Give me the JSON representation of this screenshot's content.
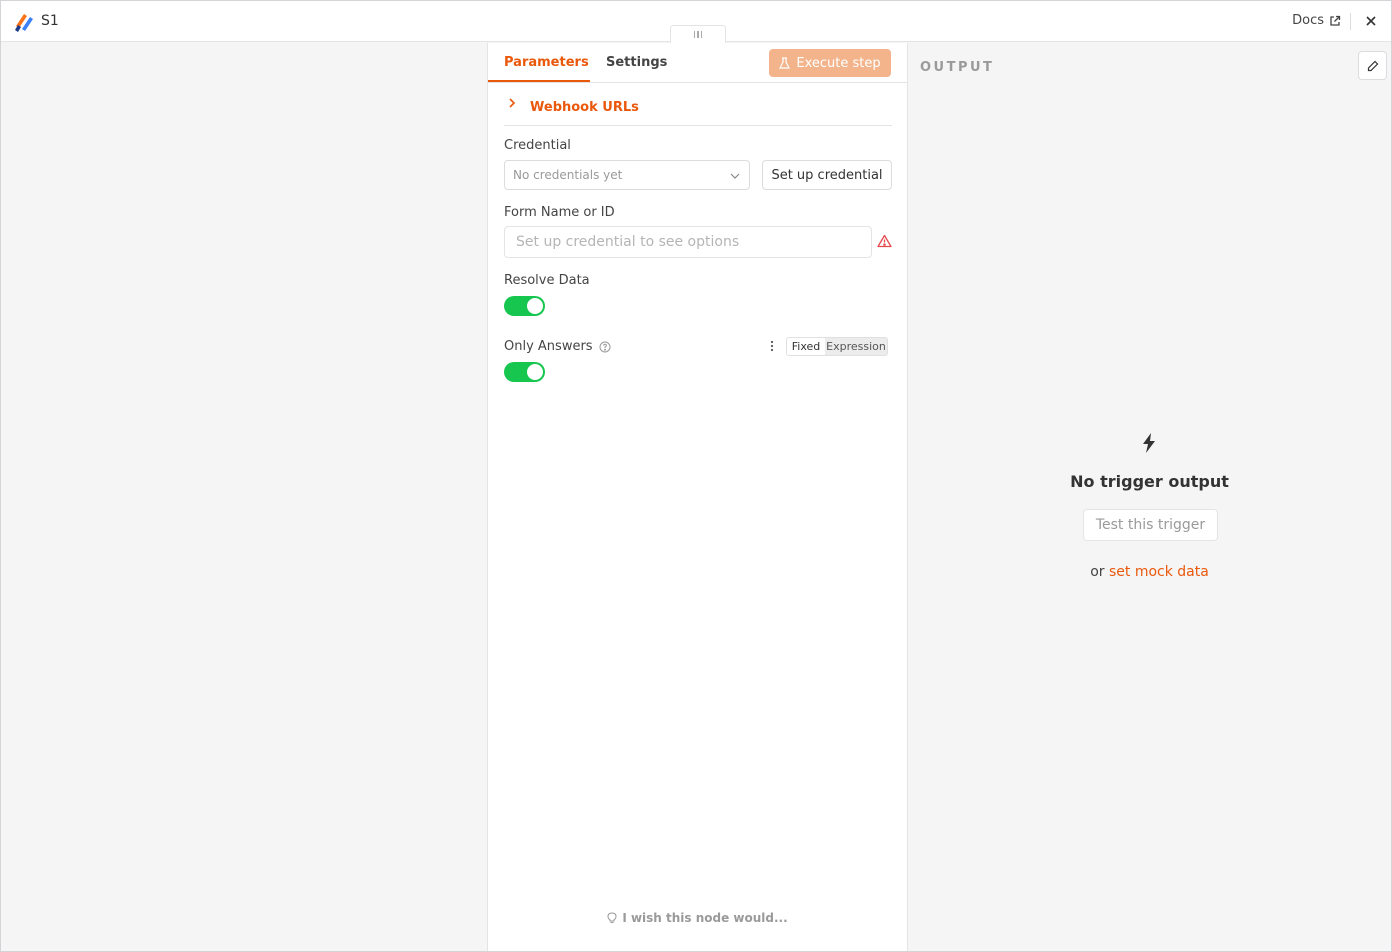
{
  "header": {
    "node_name": "S1",
    "docs_label": "Docs"
  },
  "params": {
    "tabs": [
      {
        "label": "Parameters",
        "active": true
      },
      {
        "label": "Settings",
        "active": false
      }
    ],
    "execute_label": "Execute step",
    "webhook_label": "Webhook URLs",
    "credential": {
      "label": "Credential",
      "value": "No credentials yet",
      "setup_label": "Set up credential"
    },
    "form": {
      "label": "Form Name or ID",
      "placeholder": "Set up credential to see options"
    },
    "resolve_data": {
      "label": "Resolve Data",
      "enabled": true
    },
    "only_answers": {
      "label": "Only Answers",
      "enabled": true,
      "fixed_label": "Fixed",
      "expression_label": "Expression"
    },
    "wish_label": "I wish this node would..."
  },
  "output": {
    "title": "OUTPUT",
    "no_output_text": "No trigger output",
    "test_label": "Test this trigger",
    "or_text": "or",
    "mock_label": "set mock data"
  },
  "colors": {
    "accent": "#ea580c",
    "toggle_on": "#16c64f",
    "warning": "#e5484d"
  }
}
